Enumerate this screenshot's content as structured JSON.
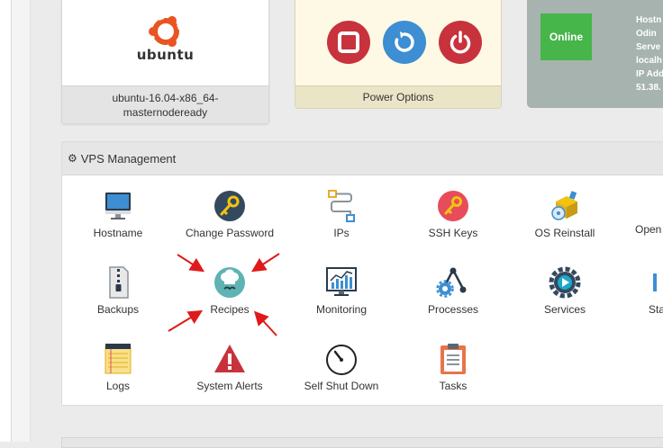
{
  "os_card": {
    "logo_text": "ubuntu",
    "label": "ubuntu-16.04-x86_64-masternodeready"
  },
  "power_card": {
    "label": "Power Options",
    "buttons": [
      "stop",
      "restart",
      "power-off"
    ]
  },
  "status_card": {
    "badge": "Online",
    "lines": [
      "Hostn",
      "Odin",
      "Serve",
      "localh",
      "IP Add",
      "51.38."
    ]
  },
  "panel": {
    "title": "VPS Management",
    "items": [
      {
        "label": "Hostname",
        "icon": "monitor-icon"
      },
      {
        "label": "Change Password",
        "icon": "key-icon"
      },
      {
        "label": "IPs",
        "icon": "ip-network-icon"
      },
      {
        "label": "SSH Keys",
        "icon": "ssh-key-icon"
      },
      {
        "label": "OS Reinstall",
        "icon": "os-reinstall-icon"
      },
      {
        "label": "Open",
        "icon": "open-icon"
      },
      {
        "label": "Backups",
        "icon": "zip-file-icon"
      },
      {
        "label": "Recipes",
        "icon": "chef-hat-icon"
      },
      {
        "label": "Monitoring",
        "icon": "monitoring-chart-icon"
      },
      {
        "label": "Processes",
        "icon": "processes-gears-icon"
      },
      {
        "label": "Services",
        "icon": "services-gear-icon"
      },
      {
        "label": "Sta",
        "icon": "stats-icon"
      },
      {
        "label": "Logs",
        "icon": "notepad-icon"
      },
      {
        "label": "System Alerts",
        "icon": "warning-icon"
      },
      {
        "label": "Self Shut Down",
        "icon": "timer-icon"
      },
      {
        "label": "Tasks",
        "icon": "clipboard-icon"
      }
    ]
  },
  "colors": {
    "online": "#46b54a",
    "power_red": "#c8323c",
    "power_blue": "#3d8ed2",
    "arrow": "#e01a1a"
  }
}
